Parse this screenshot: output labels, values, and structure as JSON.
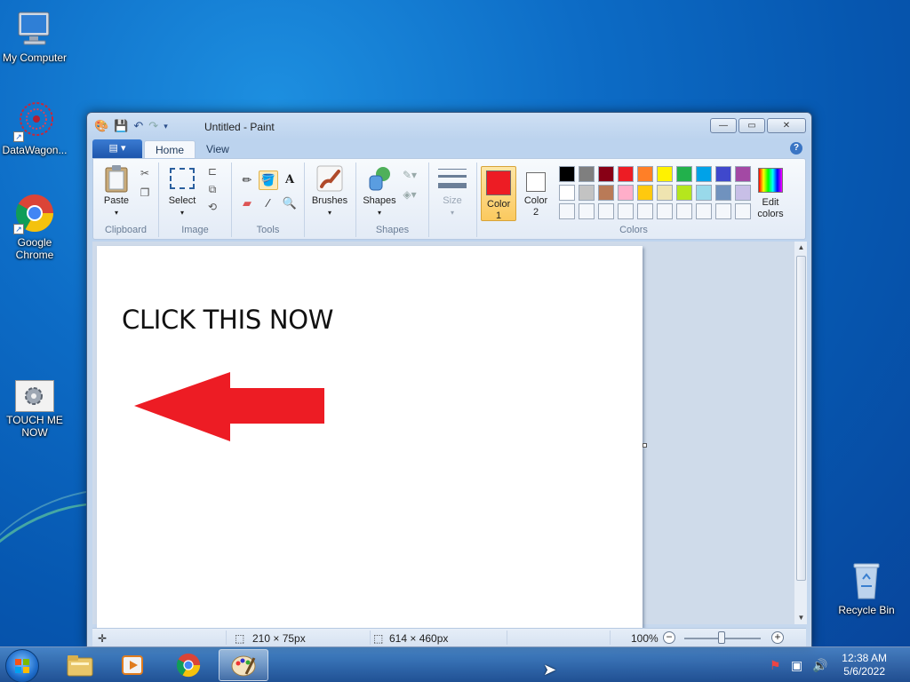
{
  "desktop": {
    "icons": [
      {
        "label": "My Computer"
      },
      {
        "label": "DataWagon..."
      },
      {
        "label": "Google Chrome"
      },
      {
        "label": "TOUCH ME NOW"
      },
      {
        "label": "Recycle Bin"
      }
    ]
  },
  "window": {
    "title": "Untitled - Paint",
    "tabs": [
      "Home",
      "View"
    ],
    "help": "?"
  },
  "ribbon": {
    "clipboard": {
      "paste": "Paste",
      "label": "Clipboard"
    },
    "image": {
      "select": "Select",
      "label": "Image"
    },
    "tools": {
      "label": "Tools",
      "text_tool": "A"
    },
    "brushes": "Brushes",
    "shapes": {
      "button": "Shapes",
      "label": "Shapes"
    },
    "size": "Size",
    "color1": "Color 1",
    "color2": "Color 2",
    "colors_label": "Colors",
    "edit_colors": "Edit colors",
    "color1_value": "#ed1c24",
    "color2_value": "#ffffff",
    "palette_row1": [
      "#000000",
      "#7f7f7f",
      "#880015",
      "#ed1c24",
      "#ff7f27",
      "#fff200",
      "#22b14c",
      "#00a2e8",
      "#3f48cc",
      "#a349a4"
    ],
    "palette_row2": [
      "#ffffff",
      "#c3c3c3",
      "#b97a57",
      "#ffaec9",
      "#ffc90e",
      "#efe4b0",
      "#b5e61d",
      "#99d9ea",
      "#7092be",
      "#c8bfe7"
    ]
  },
  "canvas": {
    "text": "CLICK THIS NOW",
    "arrow_color": "#ed1c24"
  },
  "status": {
    "selection_size": "210 × 75px",
    "image_size": "614 × 460px",
    "zoom": "100%"
  },
  "taskbar": {
    "time": "12:38 AM",
    "date": "5/6/2022"
  }
}
